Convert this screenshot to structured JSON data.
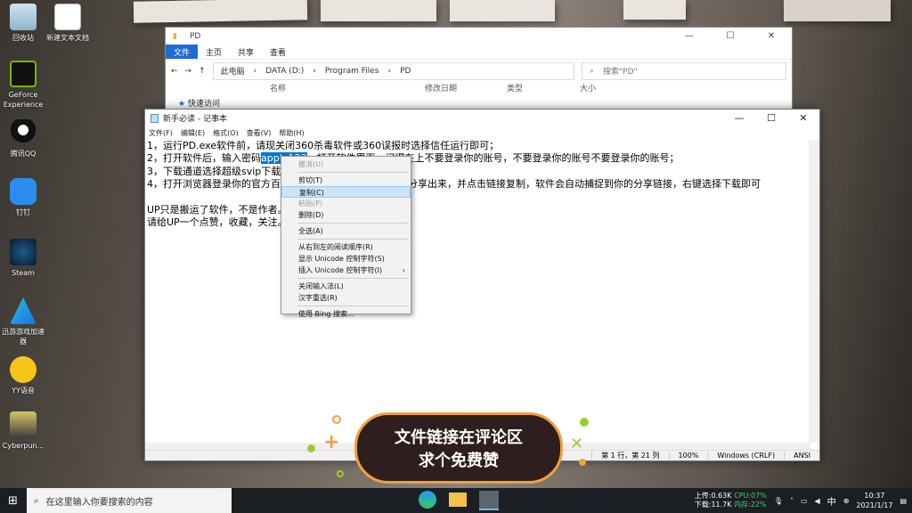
{
  "desktop": {
    "icons": [
      {
        "label": "回收站",
        "icon": "recycle-bin-icon"
      },
      {
        "label": "新建文本文档",
        "icon": "text-document-icon"
      },
      {
        "label": "GeForce Experience",
        "icon": "geforce-icon"
      },
      {
        "label": "腾讯QQ",
        "icon": "qq-icon"
      },
      {
        "label": "钉钉",
        "icon": "dingtalk-icon"
      },
      {
        "label": "Steam",
        "icon": "steam-icon"
      },
      {
        "label": "迅游游戏加速器",
        "icon": "accelerator-icon"
      },
      {
        "label": "YY语音",
        "icon": "yy-icon"
      },
      {
        "label": "Cyberpun...",
        "icon": "cyberpunk-icon"
      }
    ]
  },
  "explorer": {
    "title": "PD",
    "controls": [
      "—",
      "☐",
      "✕"
    ],
    "ribbon": {
      "file": "文件",
      "home": "主页",
      "share": "共享",
      "view": "查看"
    },
    "breadcrumb": [
      "此电脑",
      "DATA (D:)",
      "Program Files",
      "PD"
    ],
    "search_placeholder": "搜索\"PD\"",
    "columns": {
      "name": "名称",
      "modified": "修改日期",
      "type": "类型",
      "size": "大小"
    },
    "quick_access": "快速访问"
  },
  "notepad": {
    "title": "新手必读 - 记事本",
    "menu": [
      "文件(F)",
      "编辑(E)",
      "格式(O)",
      "查看(V)",
      "帮助(H)"
    ],
    "line1": "1，运行PD.exe软件前，请现关闭360杀毒软件或360误报时选择信任运行即可；",
    "line2_a": "2，打开软件后，输入密码",
    "line2_sel": "apple123",
    "line2_b": "，打开软件界面，记得在上不要登录你的账号，不要登录你的账号不要登录你的账号；",
    "line3": "3，下载通道选择超级svip下载",
    "line4": "4，打开浏览器登录你的官方百度网盘，找到要下载的文件，分享出来，并点击链接复制，软件会自动捕捉到你的分享链接，右键选择下载即可",
    "line5": "UP只是搬运了软件，不是作者。                            445966",
    "line6": "请给UP一个点赞，收藏，关注。",
    "status": {
      "pos": "第 1 行，第 21 列",
      "zoom": "100%",
      "eol": "Windows (CRLF)",
      "enc": "ANSI"
    }
  },
  "context_menu": {
    "undo": "撤消(U)",
    "cut": "剪切(T)",
    "copy": "复制(C)",
    "paste": "粘贴(P)",
    "delete": "删除(D)",
    "select_all": "全选(A)",
    "rtl": "从右到左的阅读顺序(R)",
    "show_unicode": "显示 Unicode 控制字符(S)",
    "insert_unicode": "插入 Unicode 控制字符(I)",
    "close_ime": "关闭输入法(L)",
    "reconvert": "汉字重选(R)",
    "bing": "使用 Bing 搜索..."
  },
  "banner": {
    "line1": "文件链接在评论区",
    "line2": "求个免费赞"
  },
  "taskbar": {
    "search_placeholder": "在这里输入你要搜索的内容",
    "net_up": "上传:0.63K",
    "net_down": "下载:11.7K",
    "cpu": "CPU:07%",
    "mem": "内存:22%",
    "ime": "中",
    "time": "10:37",
    "date": "2021/1/17"
  }
}
